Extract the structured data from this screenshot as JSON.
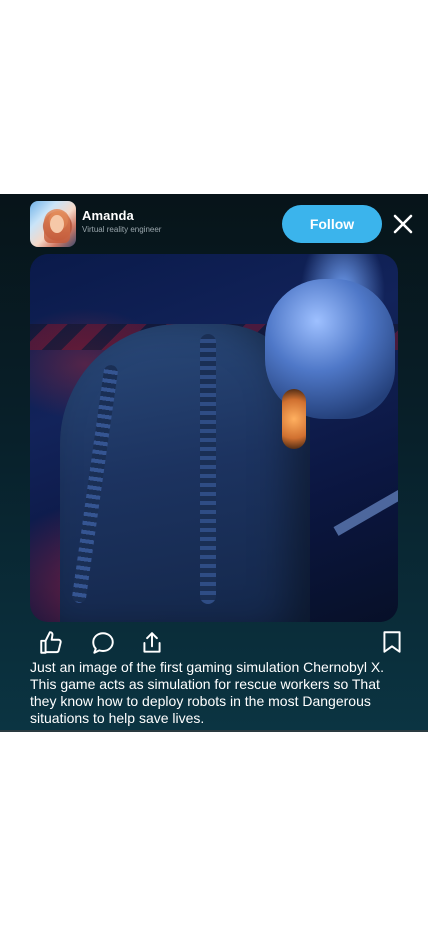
{
  "post": {
    "user": {
      "name": "Amanda",
      "role": "Virtual reality engineer",
      "avatar_icon": "avatar-photo"
    },
    "follow_label": "Follow",
    "caption": "Just an image of the first gaming simulation Chernobyl X. This game acts as simulation for rescue workers so That they know how to deploy robots in the most Dangerous situations to help save lives.",
    "image": {
      "description_icon": "post-photo"
    },
    "actions": {
      "like_icon": "thumbs-up-icon",
      "comment_icon": "comment-icon",
      "share_icon": "share-icon",
      "bookmark_icon": "bookmark-icon",
      "close_icon": "close-icon"
    }
  },
  "colors": {
    "accent": "#3bb4ec",
    "card_bg": "#08202a",
    "text": "#ffffff",
    "muted": "#9aa7ad"
  }
}
